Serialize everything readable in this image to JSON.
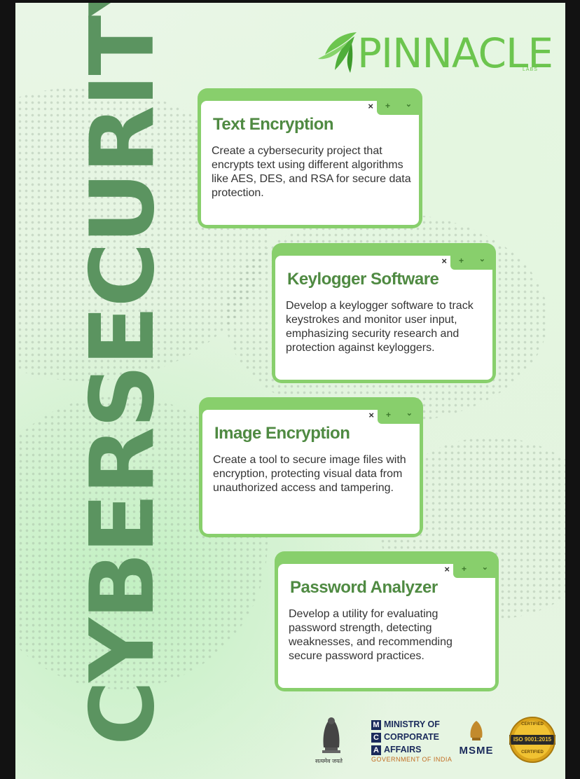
{
  "vertical_title": "CYBERSECURITY",
  "logo": {
    "name": "PINNACLE",
    "sub": "LABS"
  },
  "card_controls": {
    "close": "×",
    "add": "+",
    "menu": "⌄"
  },
  "cards": [
    {
      "title": "Text Encryption",
      "description": "Create a cybersecurity project that encrypts text using different algorithms like AES, DES, and RSA for secure data protection."
    },
    {
      "title": "Keylogger Software",
      "description": "Develop a keylogger software to track keystrokes and monitor user input, emphasizing security research and protection against keyloggers."
    },
    {
      "title": "Image Encryption",
      "description": "Create a tool to secure image files with encryption, protecting visual data from unauthorized access and tampering."
    },
    {
      "title": "Password Analyzer",
      "description": "Develop a utility for evaluating password strength, detecting weaknesses, and recommending secure password practices."
    }
  ],
  "footer": {
    "emblem_motto": "सत्यमेव जयते",
    "mca_lines": [
      "MINISTRY OF",
      "CORPORATE",
      "AFFAIRS"
    ],
    "mca_letters": [
      "M",
      "C",
      "A"
    ],
    "mca_sub": "GOVERNMENT OF INDIA",
    "msme": "MSME",
    "iso_text": "ISO 9001:2015",
    "iso_top": "CERTIFIED",
    "iso_bottom": "CERTIFIED"
  },
  "colors": {
    "accent": "#88cf6c",
    "title_green": "#4f8a42",
    "vertical_text": "#5b9460",
    "logo_green": "#6cc54e"
  }
}
